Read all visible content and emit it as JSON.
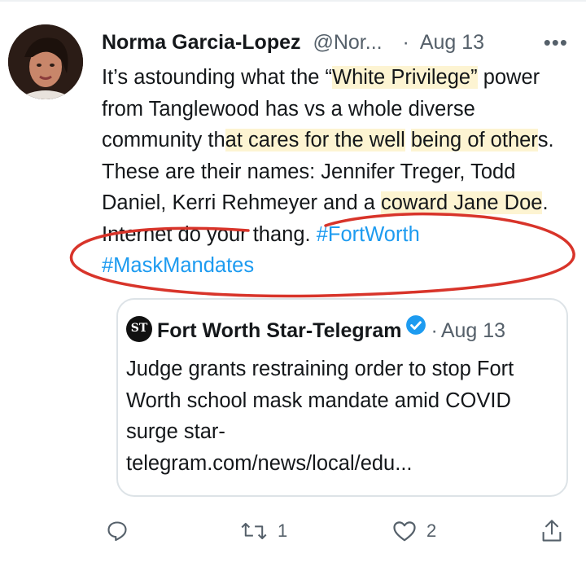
{
  "tweet": {
    "author_name": "Norma Garcia-Lopez",
    "handle": "@Nor...",
    "separator": "·",
    "date": "Aug 13",
    "more_label": "•••",
    "text_parts": [
      "It’s astounding what the “",
      "White Privilege”",
      " power from Tanglewood has vs a whole diverse community th",
      "at cares for the well",
      " ",
      "being of other",
      "s. These are their names: Jennifer Treger, Todd Daniel, Kerri Rehmeyer and a ",
      "coward Jane Doe",
      ". Internet do your thang. ",
      "#FortWorth",
      " ",
      "#MaskMandates"
    ]
  },
  "quoted": {
    "logo_text": "ST",
    "author_name": "Fort Worth Star-Telegram",
    "separator": "·",
    "date": "Aug 13",
    "text": "Judge grants restraining order to stop Fort Worth school mask mandate amid COVID surge star-",
    "link": "telegram.com/news/local/edu..."
  },
  "actions": {
    "reply_icon": "reply-icon",
    "retweet_icon": "retweet-icon",
    "retweet_count": "1",
    "like_icon": "heart-icon",
    "like_count": "2",
    "share_icon": "share-icon"
  },
  "colors": {
    "hashtag": "#1d9bf0",
    "highlight": "#fdf4d2",
    "annotation_circle": "#d8342a",
    "secondary_text": "#55606a"
  }
}
